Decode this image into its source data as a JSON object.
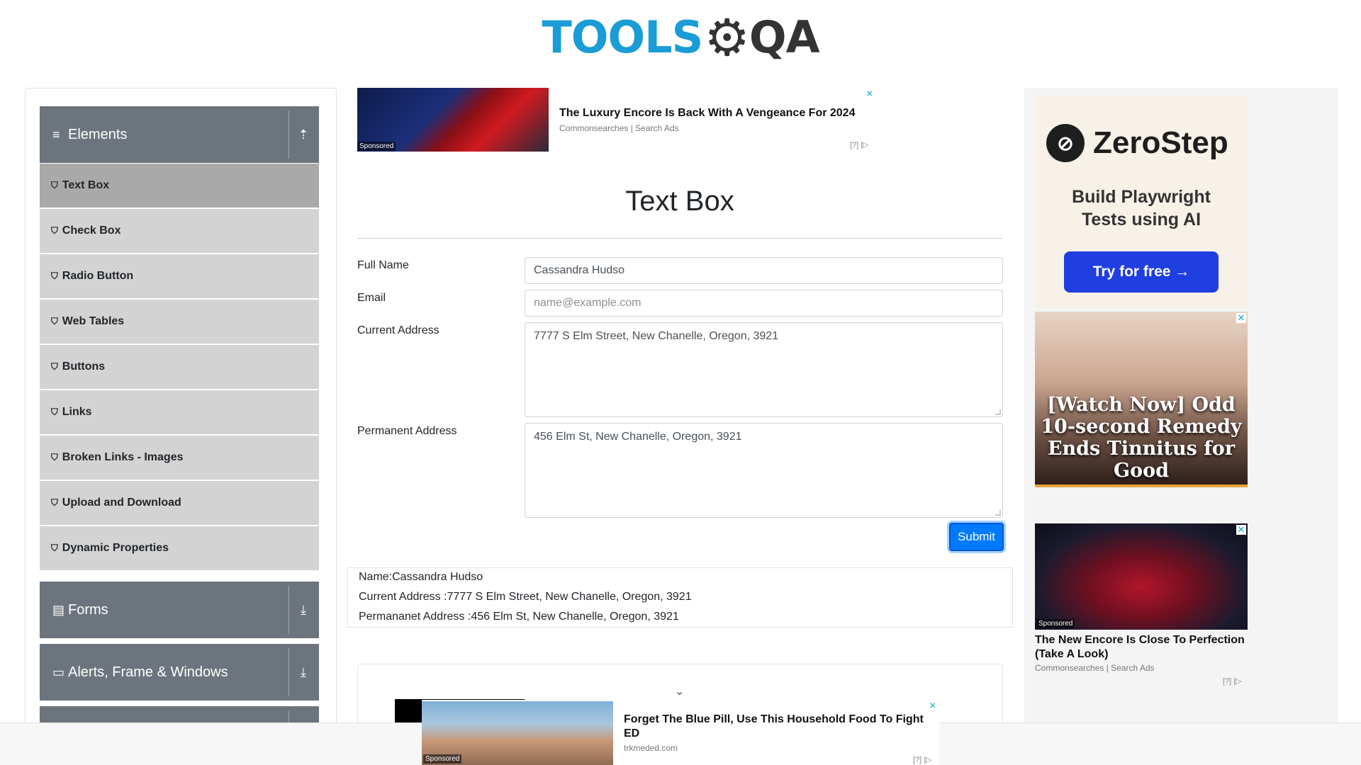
{
  "logo": {
    "part1": "TOOLS",
    "part2": "QA"
  },
  "sidebar": {
    "groups": [
      {
        "title": "Elements",
        "icon": "≡",
        "toggle": "⇡"
      },
      {
        "title": "Forms",
        "icon": "▤",
        "toggle": "⤓"
      },
      {
        "title": "Alerts, Frame & Windows",
        "icon": "▭",
        "toggle": "⤓"
      }
    ],
    "items": [
      {
        "label": "Text Box",
        "active": true
      },
      {
        "label": "Check Box"
      },
      {
        "label": "Radio Button"
      },
      {
        "label": "Web Tables"
      },
      {
        "label": "Buttons"
      },
      {
        "label": "Links"
      },
      {
        "label": "Broken Links - Images"
      },
      {
        "label": "Upload and Download"
      },
      {
        "label": "Dynamic Properties"
      }
    ]
  },
  "top_ad": {
    "title": "The Luxury Encore Is Back With A Vengeance For 2024",
    "source": "Commonsearches | Search Ads",
    "sponsored": "Sponsored",
    "close": "×",
    "info": "[?] |▷"
  },
  "page": {
    "title": "Text Box"
  },
  "form": {
    "full_name_label": "Full Name",
    "full_name_value": "Cassandra Hudso",
    "email_label": "Email",
    "email_placeholder": "name@example.com",
    "current_address_label": "Current Address",
    "current_address_value": "7777 S Elm Street, New Chanelle, Oregon, 3921",
    "permanent_address_label": "Permanent Address",
    "permanent_address_value": "456 Elm St, New Chanelle, Oregon, 3921",
    "submit_label": "Submit"
  },
  "output": {
    "name": "Name:Cassandra Hudso",
    "current_address": "Current Address :7777 S Elm Street, New Chanelle, Oregon, 3921",
    "permanent_address": "Permananet Address :456 Elm St, New Chanelle, Oregon, 3921"
  },
  "right_ads": {
    "zerostep": {
      "name": "ZeroStep",
      "tagline_line1": "Build Playwright",
      "tagline_line2": "Tests using AI",
      "cta": "Try for free →"
    },
    "tinnitus": {
      "line1": "[Watch Now] Odd",
      "line2": "10-second Remedy",
      "line3": "Ends Tinnitus for",
      "line4": "Good",
      "close": "✕"
    },
    "car": {
      "title": "The New Encore Is Close To Perfection (Take A Look)",
      "source": "Commonsearches | Search Ads",
      "sponsored": "Sponsored",
      "close": "✕",
      "info": "[?] |▷"
    }
  },
  "sticky_ad": {
    "title": "Forget The Blue Pill, Use This Household Food To Fight ED",
    "source": "trkmeded.com",
    "sponsored": "Sponsored",
    "close": "×",
    "info": "[?] |▷"
  },
  "colors": {
    "brand_blue": "#1a9cd6",
    "sidebar_header": "#6c757d",
    "submit": "#007bff",
    "ad_close": "#00aecd"
  }
}
